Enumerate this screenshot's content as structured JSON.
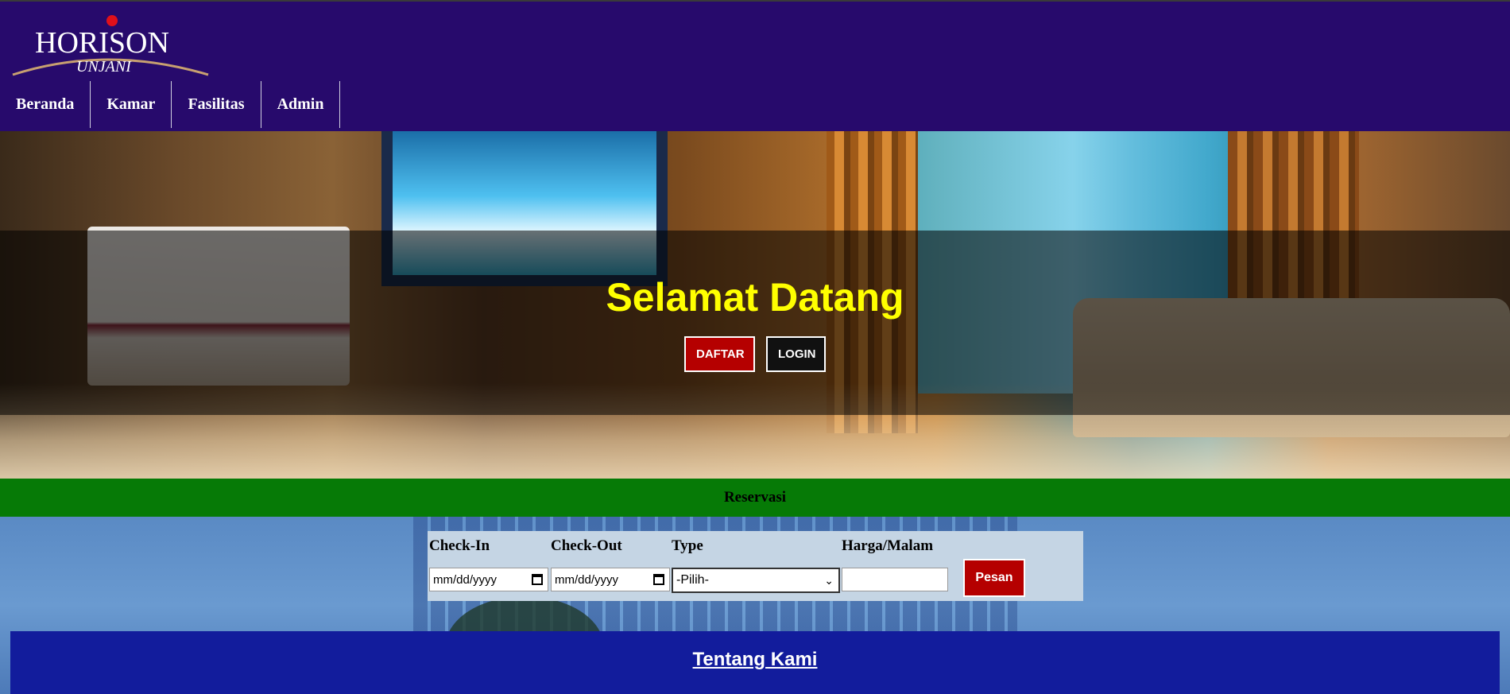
{
  "brand": {
    "name_main": "HORISON",
    "name_sub": "UNJANI"
  },
  "nav": {
    "items": [
      "Beranda",
      "Kamar",
      "Fasilitas",
      "Admin"
    ]
  },
  "hero": {
    "title": "Selamat Datang",
    "daftar_label": "DAFTAR",
    "login_label": "LOGIN"
  },
  "reservation": {
    "bar_title": "Reservasi",
    "checkin_label": "Check-In",
    "checkout_label": "Check-Out",
    "type_label": "Type",
    "harga_label": "Harga/Malam",
    "checkin_value": "mm/dd/yyyy",
    "checkout_value": "mm/dd/yyyy",
    "type_selected": "-Pilih-",
    "harga_value": "",
    "pesan_label": "Pesan"
  },
  "about": {
    "title": "Tentang Kami"
  },
  "colors": {
    "header_bg": "#270a6c",
    "accent_red": "#b50000",
    "reservation_green": "#067a06",
    "title_yellow": "#ffff00",
    "about_blue": "#121c9c"
  }
}
